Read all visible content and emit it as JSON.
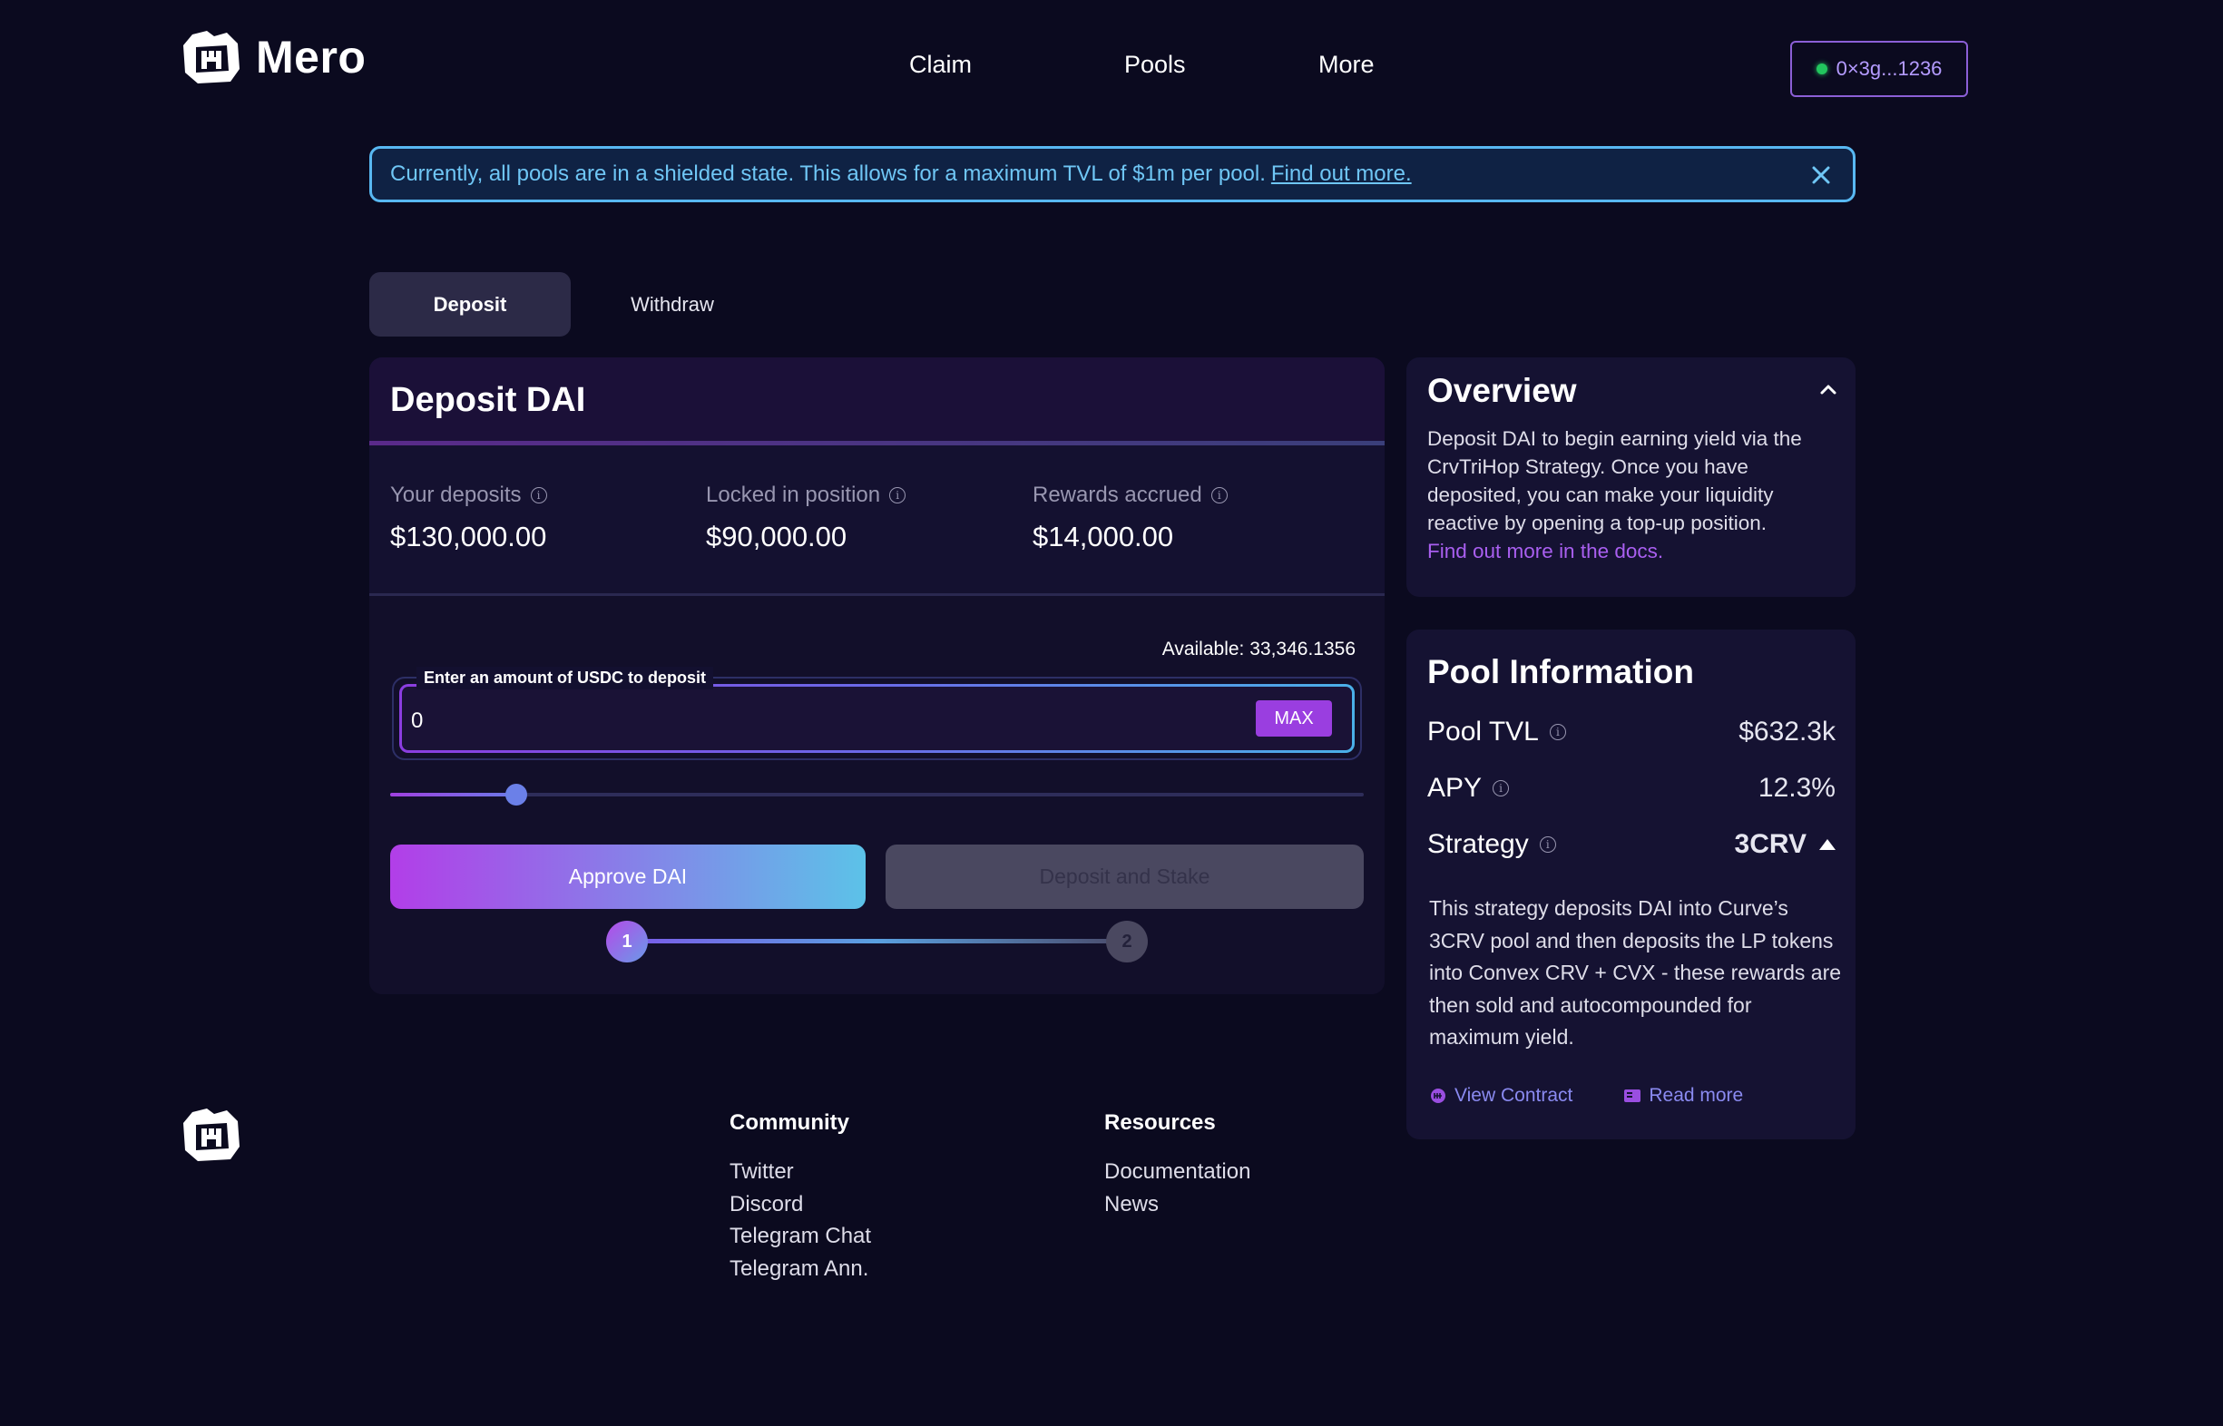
{
  "header": {
    "logo_text": "Mero",
    "nav": [
      "Claim",
      "Pools",
      "More"
    ],
    "wallet_address": "0×3g...1236"
  },
  "banner": {
    "text": "Currently, all pools are in a shielded state. This allows for a maximum TVL of $1m per pool.",
    "link": "Find out more."
  },
  "tabs": {
    "active": "Deposit",
    "inactive": "Withdraw"
  },
  "deposit_card": {
    "title": "Deposit DAI",
    "stats": [
      {
        "label": "Your deposits",
        "value": "$130,000.00"
      },
      {
        "label": "Locked in position",
        "value": "$90,000.00"
      },
      {
        "label": "Rewards accrued",
        "value": "$14,000.00"
      }
    ],
    "available": "Available: 33,346.1356",
    "input_label": "Enter an amount of USDC to deposit",
    "input_value": "0",
    "max_label": "MAX",
    "slider_fraction": 0.13,
    "approve_label": "Approve DAI",
    "deposit_label": "Deposit and Stake",
    "steps": [
      "1",
      "2"
    ]
  },
  "overview": {
    "title": "Overview",
    "text": "Deposit DAI to begin earning yield via the CrvTriHop Strategy. Once you have deposited, you can make your liquidity reactive by opening a top-up position.",
    "link": "Find out more in the docs."
  },
  "pool_info": {
    "title": "Pool Information",
    "tvl_label": "Pool TVL",
    "tvl_value": "$632.3k",
    "apy_label": "APY",
    "apy_value": "12.3%",
    "strategy_label": "Strategy",
    "strategy_value": "3CRV",
    "description": "This strategy deposits DAI into Curve’s 3CRV pool and then deposits the LP tokens into Convex CRV + CVX - these rewards are then sold and autocompounded for maximum yield.",
    "view_contract": "View Contract",
    "read_more": "Read more"
  },
  "footer": {
    "community": {
      "heading": "Community",
      "links": [
        "Twitter",
        "Discord",
        "Telegram Chat",
        "Telegram Ann."
      ]
    },
    "resources": {
      "heading": "Resources",
      "links": [
        "Documentation",
        "News"
      ]
    }
  },
  "colors": {
    "background": "#0b0a1f",
    "accent_purple": "#9a3ee0",
    "accent_blue": "#5cc2e8",
    "banner_text": "#6fc6f5",
    "link_purple": "#a95ff0"
  },
  "icons": [
    "mero-logo-icon",
    "close-icon",
    "info-icon",
    "chevron-up-icon",
    "caret-up-icon",
    "contract-icon",
    "book-icon"
  ]
}
